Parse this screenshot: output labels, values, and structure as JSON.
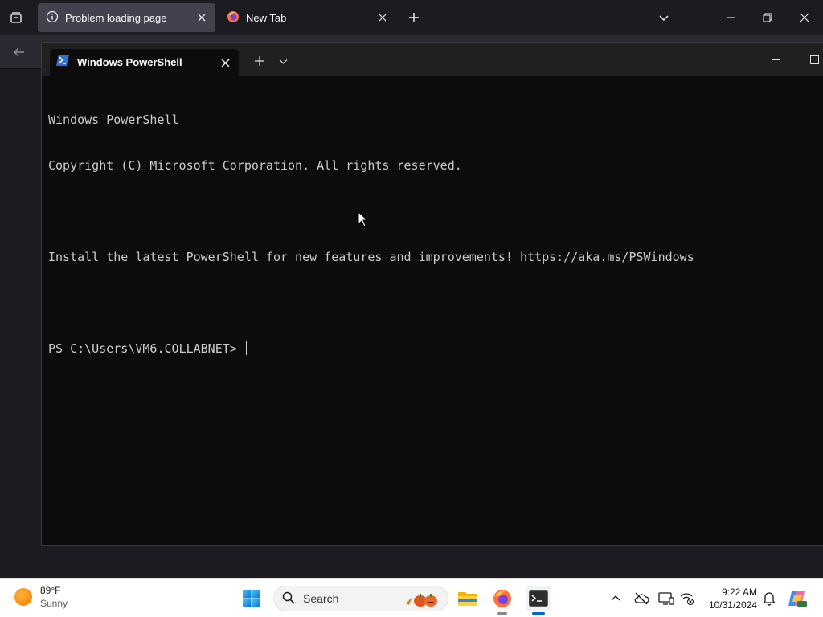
{
  "browser": {
    "tabs": [
      {
        "title": "Problem loading page",
        "active": true
      },
      {
        "title": "New Tab",
        "active": false
      }
    ]
  },
  "terminal": {
    "tab_title": "Windows PowerShell",
    "lines": [
      "Windows PowerShell",
      "Copyright (C) Microsoft Corporation. All rights reserved.",
      "",
      "Install the latest PowerShell for new features and improvements! https://aka.ms/PSWindows",
      ""
    ],
    "prompt": "PS C:\\Users\\VM6.COLLABNET> "
  },
  "taskbar": {
    "weather": {
      "temp": "89°F",
      "condition": "Sunny"
    },
    "search_label": "Search",
    "time": "9:22 AM",
    "date": "10/31/2024"
  },
  "colors": {
    "firefox_bg": "#1c1b22",
    "terminal_bg": "#0c0c0c",
    "terminal_text": "#cccccc",
    "taskbar_bg": "#ffffff",
    "accent": "#0067c0"
  }
}
